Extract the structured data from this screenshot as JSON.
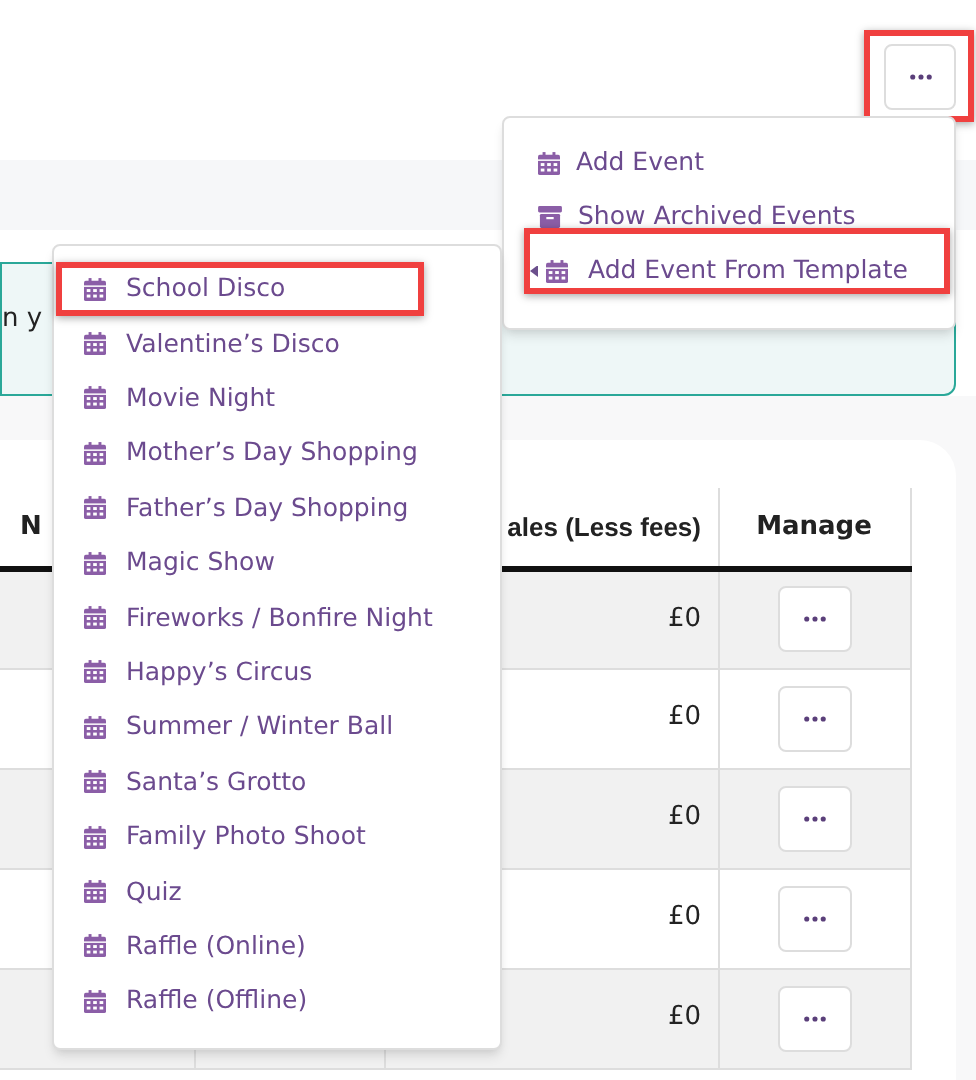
{
  "more_button": {
    "highlighted": true
  },
  "alert": {
    "text": "n y"
  },
  "actions_menu": [
    {
      "kind": "calendar",
      "label": "Add Event",
      "highlighted": false,
      "submenu": false
    },
    {
      "kind": "archive",
      "label": "Show Archived Events",
      "highlighted": false,
      "submenu": false
    },
    {
      "kind": "calendar",
      "label": "Add Event From Template",
      "highlighted": true,
      "submenu": true
    }
  ],
  "template_menu": [
    {
      "label": "School Disco",
      "highlighted": true
    },
    {
      "label": "Valentine’s Disco",
      "highlighted": false
    },
    {
      "label": "Movie Night",
      "highlighted": false
    },
    {
      "label": "Mother’s Day Shopping",
      "highlighted": false
    },
    {
      "label": "Father’s Day Shopping",
      "highlighted": false
    },
    {
      "label": "Magic Show",
      "highlighted": false
    },
    {
      "label": "Fireworks / Bonfire Night",
      "highlighted": false
    },
    {
      "label": "Happy’s Circus",
      "highlighted": false
    },
    {
      "label": "Summer / Winter Ball",
      "highlighted": false
    },
    {
      "label": "Santa’s Grotto",
      "highlighted": false
    },
    {
      "label": "Family Photo Shoot",
      "highlighted": false
    },
    {
      "label": "Quiz",
      "highlighted": false
    },
    {
      "label": "Raffle (Online)",
      "highlighted": false
    },
    {
      "label": "Raffle (Offline)",
      "highlighted": false
    }
  ],
  "table": {
    "columns": [
      "N",
      "",
      "ales (Less fees)",
      "Manage"
    ],
    "rows": [
      {
        "sales": "£0"
      },
      {
        "sales": "£0"
      },
      {
        "sales": "£0"
      },
      {
        "sales": "£0"
      },
      {
        "sales": "£0"
      }
    ]
  }
}
